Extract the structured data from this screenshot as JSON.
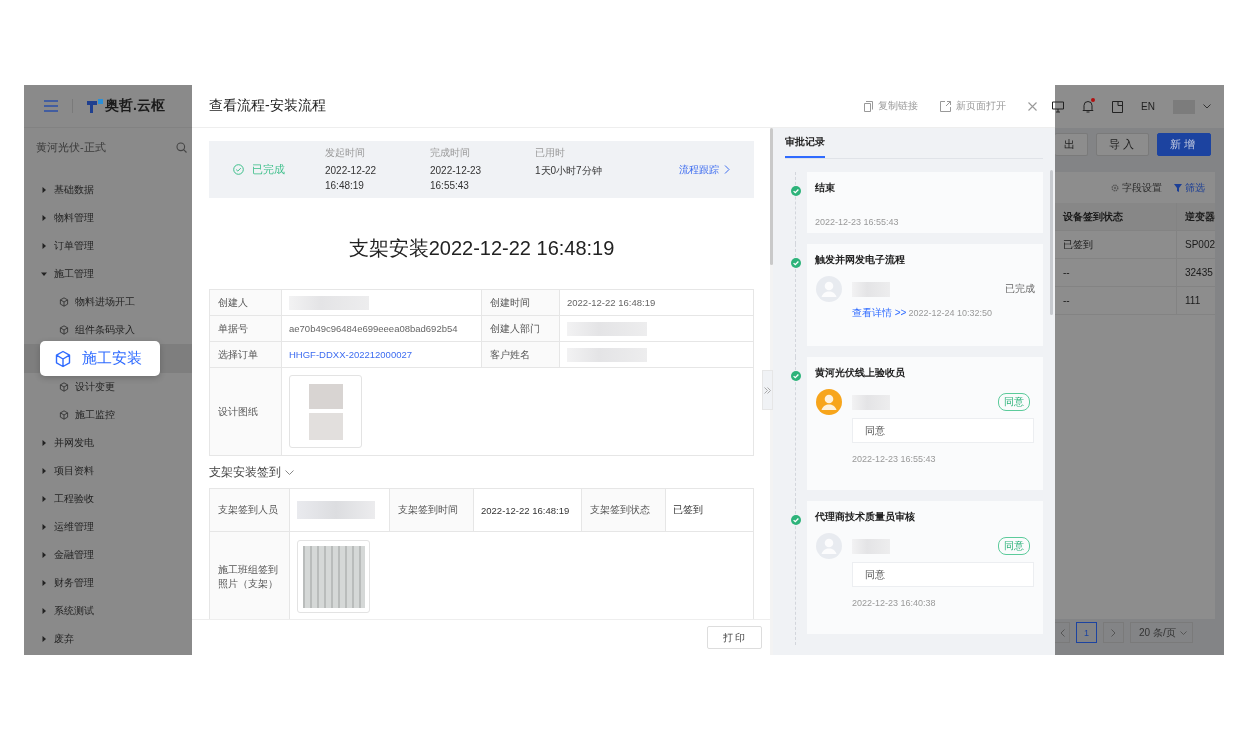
{
  "sidebar": {
    "logo": "奥哲.云枢",
    "workspace": "黄河光伏-正式",
    "items": [
      {
        "label": "基础数据",
        "expanded": false
      },
      {
        "label": "物料管理",
        "expanded": false
      },
      {
        "label": "订单管理",
        "expanded": false
      },
      {
        "label": "施工管理",
        "expanded": true,
        "children": [
          {
            "label": "物料进场开工",
            "selected": false
          },
          {
            "label": "组件条码录入",
            "selected": false
          },
          {
            "label": "施工安装",
            "selected": true
          },
          {
            "label": "设计变更",
            "selected": false
          },
          {
            "label": "施工监控",
            "selected": false
          }
        ]
      },
      {
        "label": "并网发电",
        "expanded": false
      },
      {
        "label": "项目资料",
        "expanded": false
      },
      {
        "label": "工程验收",
        "expanded": false
      },
      {
        "label": "运维管理",
        "expanded": false
      },
      {
        "label": "金融管理",
        "expanded": false
      },
      {
        "label": "财务管理",
        "expanded": false
      },
      {
        "label": "系统测试",
        "expanded": false
      },
      {
        "label": "废弃",
        "expanded": false
      }
    ]
  },
  "modal": {
    "title": "查看流程-安装流程",
    "actions": [
      {
        "label": "复制链接",
        "kind": "copy"
      },
      {
        "label": "新页面打开",
        "kind": "open"
      }
    ],
    "status": {
      "state": "已完成",
      "fields": [
        {
          "label": "发起时间",
          "value": "2022-12-22 16:48:19"
        },
        {
          "label": "完成时间",
          "value": "2022-12-23 16:55:43"
        },
        {
          "label": "已用时",
          "value": "1天0小时7分钟"
        }
      ],
      "track_link": "流程跟踪"
    },
    "document_title": "支架安装2022-12-22 16:48:19",
    "info_fields": [
      {
        "label": "创建人",
        "kind": "blurred"
      },
      {
        "label": "创建时间",
        "kind": "text",
        "value": "2022-12-22 16:48:19"
      },
      {
        "label": "单据号",
        "kind": "text",
        "value": "ae70b49c96484e699eeea08bad692b54"
      },
      {
        "label": "创建人部门",
        "kind": "blurred"
      },
      {
        "label": "选择订单",
        "kind": "link",
        "value": "HHGF-DDXX-202212000027"
      },
      {
        "label": "客户姓名",
        "kind": "blurred"
      },
      {
        "label": "设计图纸",
        "kind": "image"
      }
    ],
    "signin": {
      "title": "支架安装签到",
      "expanded": true,
      "fields": [
        {
          "label": "支架签到人员",
          "kind": "blurred"
        },
        {
          "label": "支架签到时间",
          "kind": "text",
          "value": "2022-12-22 16:48:19"
        },
        {
          "label": "支架签到状态",
          "kind": "text",
          "value": "已签到"
        },
        {
          "label": "施工班组签到照片（支架）",
          "kind": "image"
        }
      ]
    },
    "print_button": "打印",
    "approval_panel": {
      "tab": "审批记录",
      "records": [
        {
          "kind": "end",
          "title": "结束",
          "done": true,
          "time": "2022-12-23 16:55:43"
        },
        {
          "kind": "auto",
          "title": "触发并网发电子流程",
          "done": true,
          "color": "#e8ebf0",
          "result": "已完成",
          "link": "查看详情 >>",
          "time": "2022-12-24 10:32:50"
        },
        {
          "kind": "approval",
          "title": "黄河光伏线上验收员",
          "done": true,
          "color": "#f7a51c",
          "tag": "同意",
          "comment": "同意",
          "time": "2022-12-23 16:55:43"
        },
        {
          "kind": "approval",
          "title": "代理商技术质量员审核",
          "done": true,
          "color": "#e8ebf0",
          "tag": "同意",
          "comment": "同意",
          "time": "2022-12-23 16:40:38"
        }
      ]
    }
  },
  "background_app": {
    "language": "EN",
    "unread": true,
    "buttons": [
      {
        "label": "出",
        "kind": "default"
      },
      {
        "label": "导入",
        "kind": "default"
      },
      {
        "label": "新增",
        "kind": "primary"
      }
    ],
    "tools": [
      {
        "label": "字段设置",
        "kind": "settings"
      },
      {
        "label": "筛选",
        "kind": "filter"
      }
    ],
    "table": {
      "columns": [
        "设备签到状态",
        "逆变器"
      ],
      "rows": [
        [
          "已签到",
          "SP002"
        ],
        [
          "--",
          "32435"
        ],
        [
          "--",
          "111"
        ]
      ]
    },
    "pagination": {
      "pages": [
        {
          "label": "1",
          "selected": true
        }
      ],
      "page_size": "20 条/页"
    }
  }
}
